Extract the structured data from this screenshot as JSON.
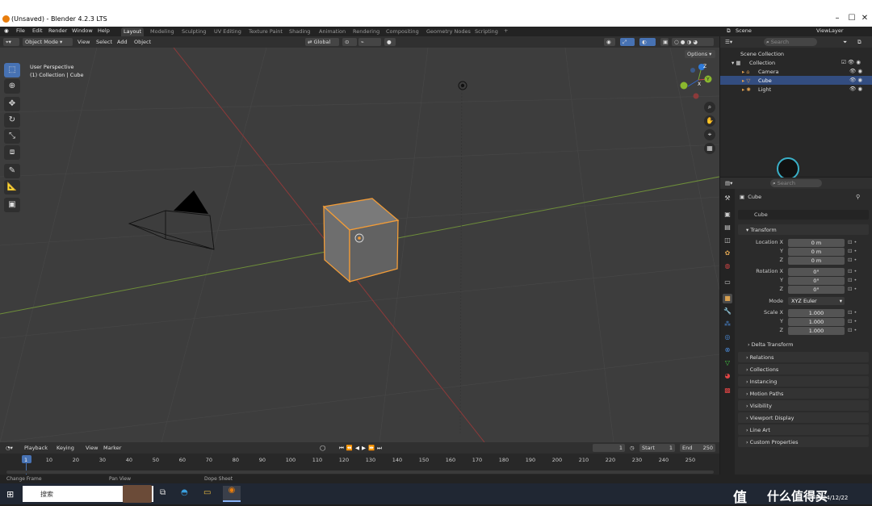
{
  "window": {
    "title": "(Unsaved) - Blender 4.2.3 LTS"
  },
  "menu": [
    "File",
    "Edit",
    "Render",
    "Window",
    "Help"
  ],
  "workspace_tabs": [
    "Layout",
    "Modeling",
    "Sculpting",
    "UV Editing",
    "Texture Paint",
    "Shading",
    "Animation",
    "Rendering",
    "Compositing",
    "Geometry Nodes",
    "Scripting"
  ],
  "top_right": {
    "scene": "Scene",
    "view_layer": "ViewLayer"
  },
  "viewport_header": {
    "mode": "Object Mode",
    "view": "View",
    "select": "Select",
    "add": "Add",
    "object": "Object",
    "orientation": "Global",
    "options": "Options"
  },
  "viewport": {
    "perspective": "User Perspective",
    "context": "(1) Collection | Cube"
  },
  "gizmo": {
    "x": "X",
    "y": "Y",
    "z": "Z"
  },
  "outliner": {
    "search_placeholder": "Search",
    "scene_collection": "Scene Collection",
    "collection": "Collection",
    "items": [
      "Camera",
      "Cube",
      "Light"
    ]
  },
  "properties": {
    "search_placeholder": "Search",
    "object_name": "Cube",
    "data_name": "Cube",
    "transform": "Transform",
    "location_label": "Location X",
    "loc_x": "0 m",
    "loc_y": "0 m",
    "loc_z": "0 m",
    "rotation_label": "Rotation X",
    "rot_x": "0°",
    "rot_y": "0°",
    "rot_z": "0°",
    "mode_label": "Mode",
    "mode_value": "XYZ Euler",
    "scale_label": "Scale X",
    "scale_x": "1.000",
    "scale_y": "1.000",
    "scale_z": "1.000",
    "y": "Y",
    "z": "Z",
    "delta": "Delta Transform",
    "sections": [
      "Relations",
      "Collections",
      "Instancing",
      "Motion Paths",
      "Visibility",
      "Viewport Display",
      "Line Art",
      "Custom Properties"
    ]
  },
  "timeline": {
    "playback": "Playback",
    "keying": "Keying",
    "view": "View",
    "marker": "Marker",
    "current": "1",
    "start_label": "Start",
    "start": "1",
    "end_label": "End",
    "end": "250",
    "ticks": [
      "1",
      "10",
      "20",
      "30",
      "40",
      "50",
      "60",
      "70",
      "80",
      "90",
      "100",
      "110",
      "120",
      "130",
      "140",
      "150",
      "160",
      "170",
      "180",
      "190",
      "200",
      "210",
      "220",
      "230",
      "240",
      "250"
    ]
  },
  "status": {
    "change_frame": "Change Frame",
    "pan_view": "Pan View",
    "dope_sheet": "Dope Sheet"
  },
  "taskbar": {
    "search": "搜索",
    "date": "2024/12/22",
    "watermark": "什么值得买"
  }
}
